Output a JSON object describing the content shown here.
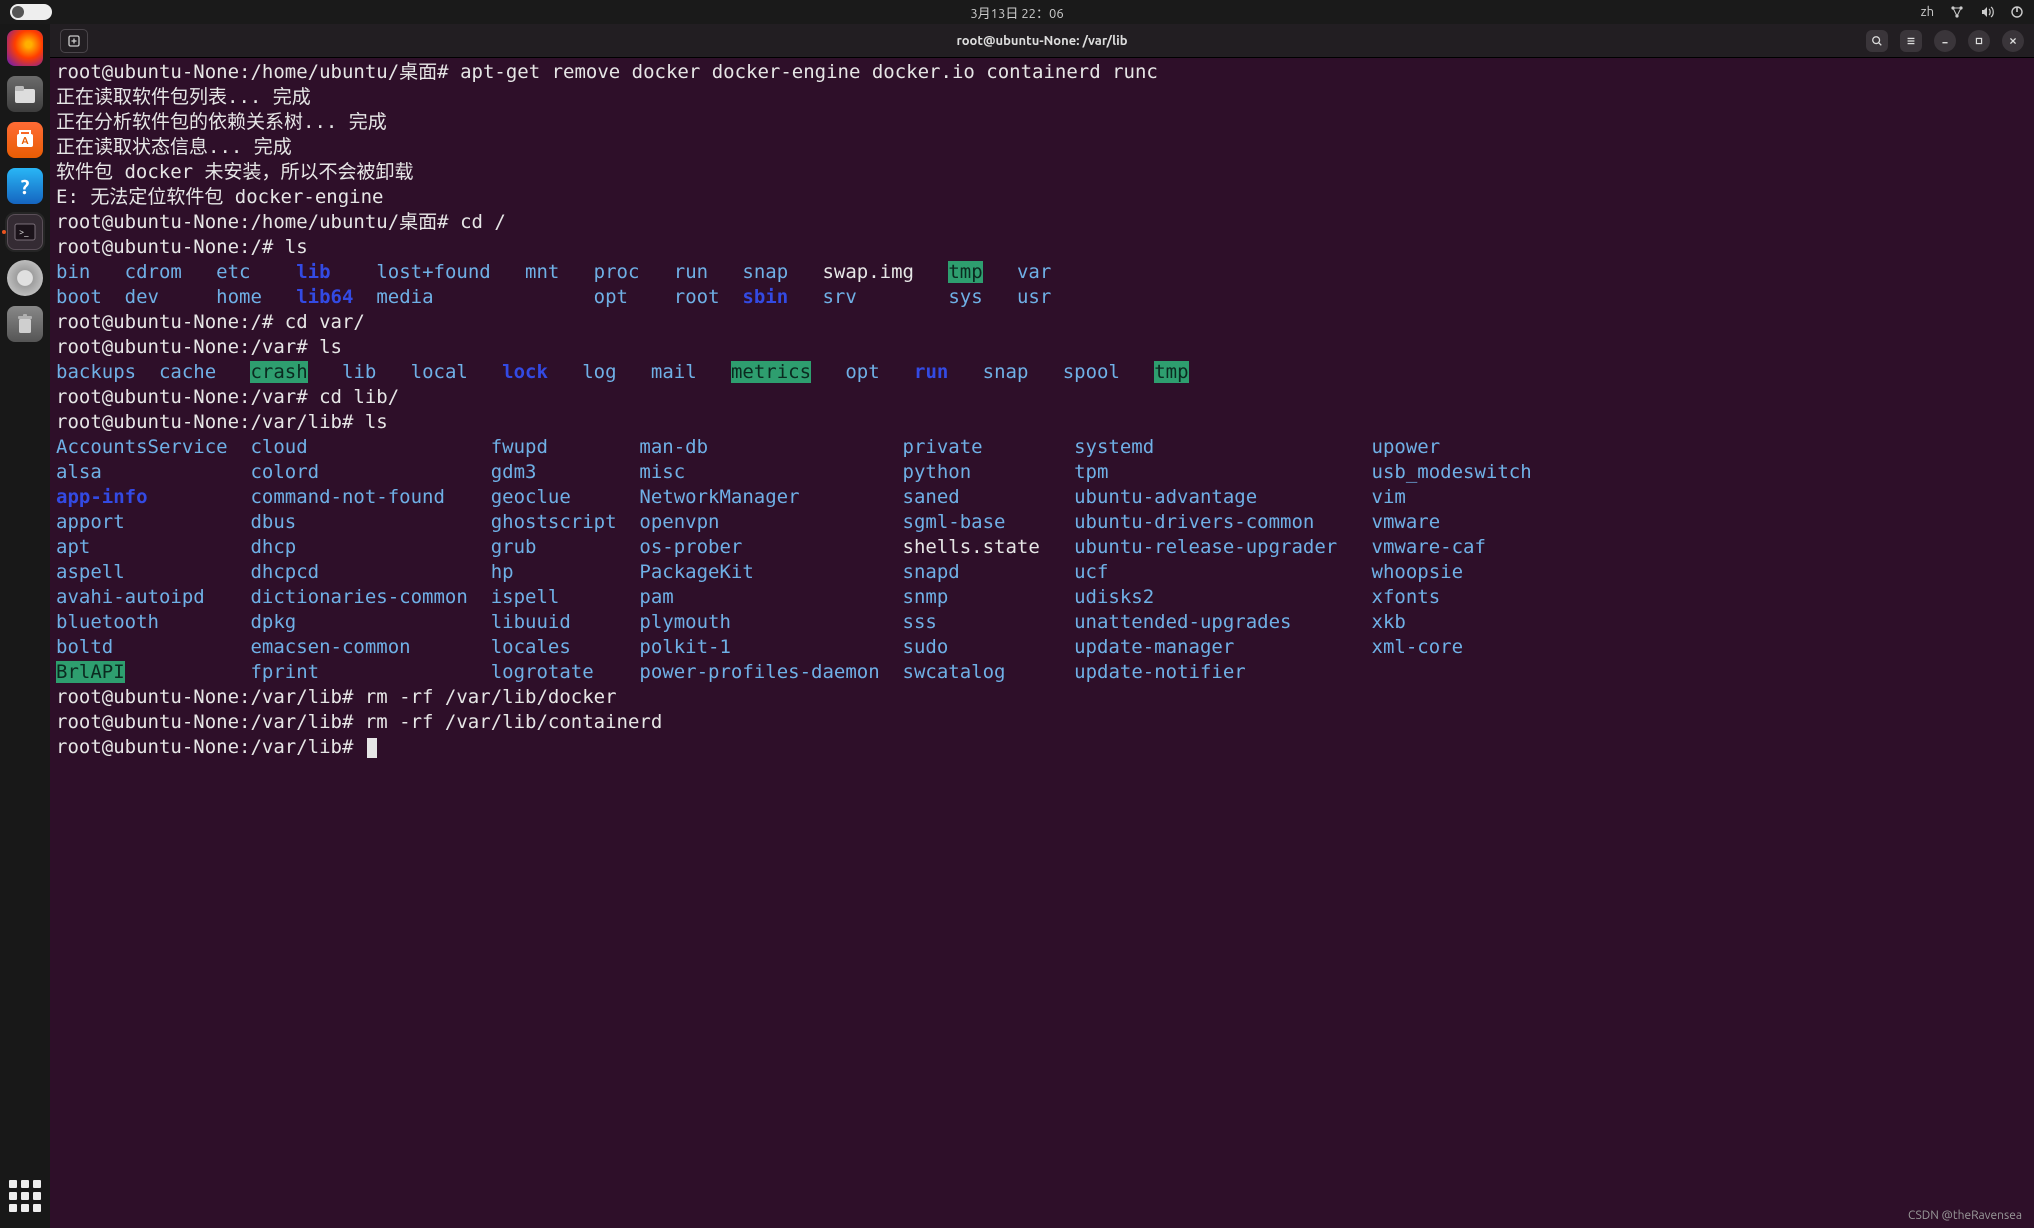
{
  "topbar": {
    "datetime": "3月13日 22：06",
    "language": "zh"
  },
  "dock": {
    "items": [
      {
        "name": "firefox",
        "label": "Firefox"
      },
      {
        "name": "files",
        "label": "文件"
      },
      {
        "name": "software",
        "label": "Ubuntu Software"
      },
      {
        "name": "help",
        "label": "?"
      },
      {
        "name": "terminal",
        "label": ">_",
        "active": true
      },
      {
        "name": "disk",
        "label": "光盘"
      },
      {
        "name": "trash",
        "label": "回收站"
      }
    ],
    "show_apps_tooltip": "显示应用程序"
  },
  "window": {
    "title": "root@ubuntu-None: /var/lib",
    "newtab_tooltip": "新建标签页"
  },
  "terminal": {
    "blocks": [
      {
        "type": "cmd",
        "prompt": "root@ubuntu-None:/home/ubuntu/桌面# ",
        "command": "apt-get remove docker docker-engine docker.io containerd runc"
      },
      {
        "type": "plain",
        "text": "正在读取软件包列表... 完成"
      },
      {
        "type": "plain",
        "text": "正在分析软件包的依赖关系树... 完成"
      },
      {
        "type": "plain",
        "text": "正在读取状态信息... 完成"
      },
      {
        "type": "plain",
        "text": "软件包 docker 未安装，所以不会被卸载"
      },
      {
        "type": "plain",
        "text": "E: 无法定位软件包 docker-engine"
      },
      {
        "type": "cmd",
        "prompt": "root@ubuntu-None:/home/ubuntu/桌面# ",
        "command": "cd /"
      },
      {
        "type": "cmd",
        "prompt": "root@ubuntu-None:/# ",
        "command": "ls"
      },
      {
        "type": "cols",
        "cols": [
          [
            "bin",
            "lb"
          ],
          [
            "cdrom",
            "lb"
          ],
          [
            "etc",
            "lb"
          ],
          [
            "lib",
            "db"
          ],
          [
            "lost+found",
            "lb"
          ],
          [
            "mnt",
            "lb"
          ],
          [
            "proc",
            "lb"
          ],
          [
            "run",
            "lb"
          ],
          [
            "snap",
            "lb"
          ],
          [
            "swap.img",
            "w"
          ],
          [
            "tmp",
            "hl"
          ],
          [
            "var",
            "lb"
          ]
        ],
        "widths": [
          6,
          8,
          7,
          7,
          13,
          6,
          7,
          6,
          7,
          11,
          6,
          5
        ]
      },
      {
        "type": "cols",
        "cols": [
          [
            "boot",
            "lb"
          ],
          [
            "dev",
            "lb"
          ],
          [
            "home",
            "lb"
          ],
          [
            "lib64",
            "db"
          ],
          [
            "media",
            "lb"
          ],
          [
            "",
            "w"
          ],
          [
            "opt",
            "lb"
          ],
          [
            "root",
            "lb"
          ],
          [
            "sbin",
            "db"
          ],
          [
            "srv",
            "lb"
          ],
          [
            "sys",
            "lb"
          ],
          [
            "usr",
            "lb"
          ]
        ],
        "widths": [
          6,
          8,
          7,
          7,
          13,
          6,
          7,
          6,
          7,
          11,
          6,
          5
        ]
      },
      {
        "type": "cmd",
        "prompt": "root@ubuntu-None:/# ",
        "command": "cd var/"
      },
      {
        "type": "cmd",
        "prompt": "root@ubuntu-None:/var# ",
        "command": "ls"
      },
      {
        "type": "cols",
        "cols": [
          [
            "backups",
            "lb"
          ],
          [
            "cache",
            "lb"
          ],
          [
            "crash",
            "hl"
          ],
          [
            "lib",
            "lb"
          ],
          [
            "local",
            "lb"
          ],
          [
            "lock",
            "db"
          ],
          [
            "log",
            "lb"
          ],
          [
            "mail",
            "lb"
          ],
          [
            "metrics",
            "hl"
          ],
          [
            "opt",
            "lb"
          ],
          [
            "run",
            "db"
          ],
          [
            "snap",
            "lb"
          ],
          [
            "spool",
            "lb"
          ],
          [
            "tmp",
            "hl"
          ]
        ],
        "widths": [
          9,
          8,
          8,
          6,
          8,
          7,
          6,
          7,
          10,
          6,
          6,
          7,
          8,
          4
        ]
      },
      {
        "type": "cmd",
        "prompt": "root@ubuntu-None:/var# ",
        "command": "cd lib/"
      },
      {
        "type": "cmd",
        "prompt": "root@ubuntu-None:/var/lib# ",
        "command": "ls"
      },
      {
        "type": "cols",
        "cols": [
          [
            "AccountsService",
            "lb"
          ],
          [
            "cloud",
            "lb"
          ],
          [
            "fwupd",
            "lb"
          ],
          [
            "man-db",
            "lb"
          ],
          [
            "private",
            "lb"
          ],
          [
            "systemd",
            "lb"
          ],
          [
            "upower",
            "lb"
          ]
        ],
        "widths": [
          17,
          21,
          13,
          23,
          15,
          26,
          15
        ]
      },
      {
        "type": "cols",
        "cols": [
          [
            "alsa",
            "lb"
          ],
          [
            "colord",
            "lb"
          ],
          [
            "gdm3",
            "lb"
          ],
          [
            "misc",
            "lb"
          ],
          [
            "python",
            "lb"
          ],
          [
            "tpm",
            "lb"
          ],
          [
            "usb_modeswitch",
            "lb"
          ]
        ],
        "widths": [
          17,
          21,
          13,
          23,
          15,
          26,
          15
        ]
      },
      {
        "type": "cols",
        "cols": [
          [
            "app-info",
            "db"
          ],
          [
            "command-not-found",
            "lb"
          ],
          [
            "geoclue",
            "lb"
          ],
          [
            "NetworkManager",
            "lb"
          ],
          [
            "saned",
            "lb"
          ],
          [
            "ubuntu-advantage",
            "lb"
          ],
          [
            "vim",
            "lb"
          ]
        ],
        "widths": [
          17,
          21,
          13,
          23,
          15,
          26,
          15
        ]
      },
      {
        "type": "cols",
        "cols": [
          [
            "apport",
            "lb"
          ],
          [
            "dbus",
            "lb"
          ],
          [
            "ghostscript",
            "lb"
          ],
          [
            "openvpn",
            "lb"
          ],
          [
            "sgml-base",
            "lb"
          ],
          [
            "ubuntu-drivers-common",
            "lb"
          ],
          [
            "vmware",
            "lb"
          ]
        ],
        "widths": [
          17,
          21,
          13,
          23,
          15,
          26,
          15
        ]
      },
      {
        "type": "cols",
        "cols": [
          [
            "apt",
            "lb"
          ],
          [
            "dhcp",
            "lb"
          ],
          [
            "grub",
            "lb"
          ],
          [
            "os-prober",
            "lb"
          ],
          [
            "shells.state",
            "w"
          ],
          [
            "ubuntu-release-upgrader",
            "lb"
          ],
          [
            "vmware-caf",
            "lb"
          ]
        ],
        "widths": [
          17,
          21,
          13,
          23,
          15,
          26,
          15
        ]
      },
      {
        "type": "cols",
        "cols": [
          [
            "aspell",
            "lb"
          ],
          [
            "dhcpcd",
            "lb"
          ],
          [
            "hp",
            "lb"
          ],
          [
            "PackageKit",
            "lb"
          ],
          [
            "snapd",
            "lb"
          ],
          [
            "ucf",
            "lb"
          ],
          [
            "whoopsie",
            "lb"
          ]
        ],
        "widths": [
          17,
          21,
          13,
          23,
          15,
          26,
          15
        ]
      },
      {
        "type": "cols",
        "cols": [
          [
            "avahi-autoipd",
            "lb"
          ],
          [
            "dictionaries-common",
            "lb"
          ],
          [
            "ispell",
            "lb"
          ],
          [
            "pam",
            "lb"
          ],
          [
            "snmp",
            "lb"
          ],
          [
            "udisks2",
            "lb"
          ],
          [
            "xfonts",
            "lb"
          ]
        ],
        "widths": [
          17,
          21,
          13,
          23,
          15,
          26,
          15
        ]
      },
      {
        "type": "cols",
        "cols": [
          [
            "bluetooth",
            "lb"
          ],
          [
            "dpkg",
            "lb"
          ],
          [
            "libuuid",
            "lb"
          ],
          [
            "plymouth",
            "lb"
          ],
          [
            "sss",
            "lb"
          ],
          [
            "unattended-upgrades",
            "lb"
          ],
          [
            "xkb",
            "lb"
          ]
        ],
        "widths": [
          17,
          21,
          13,
          23,
          15,
          26,
          15
        ]
      },
      {
        "type": "cols",
        "cols": [
          [
            "boltd",
            "lb"
          ],
          [
            "emacsen-common",
            "lb"
          ],
          [
            "locales",
            "lb"
          ],
          [
            "polkit-1",
            "lb"
          ],
          [
            "sudo",
            "lb"
          ],
          [
            "update-manager",
            "lb"
          ],
          [
            "xml-core",
            "lb"
          ]
        ],
        "widths": [
          17,
          21,
          13,
          23,
          15,
          26,
          15
        ]
      },
      {
        "type": "cols",
        "cols": [
          [
            "BrlAPI",
            "hl"
          ],
          [
            "fprint",
            "lb"
          ],
          [
            "logrotate",
            "lb"
          ],
          [
            "power-profiles-daemon",
            "lb"
          ],
          [
            "swcatalog",
            "lb"
          ],
          [
            "update-notifier",
            "lb"
          ],
          [
            "",
            "w"
          ]
        ],
        "widths": [
          17,
          21,
          13,
          23,
          15,
          26,
          15
        ]
      },
      {
        "type": "cmd",
        "prompt": "root@ubuntu-None:/var/lib# ",
        "command": "rm -rf /var/lib/docker"
      },
      {
        "type": "cmd",
        "prompt": "root@ubuntu-None:/var/lib# ",
        "command": "rm -rf /var/lib/containerd"
      },
      {
        "type": "cmd",
        "prompt": "root@ubuntu-None:/var/lib# ",
        "command": "",
        "cursor": true
      }
    ]
  },
  "watermark": "CSDN @theRavensea"
}
